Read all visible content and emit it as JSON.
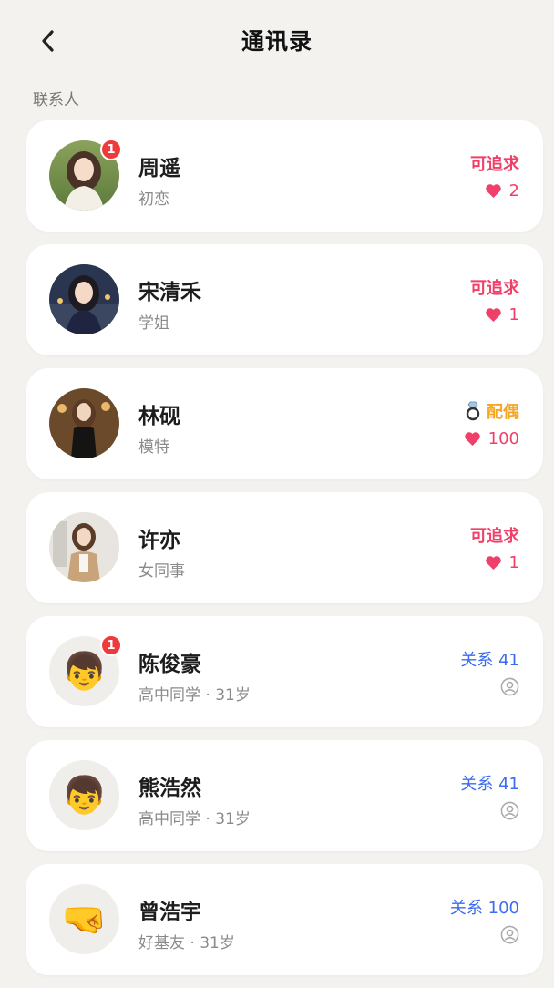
{
  "header": {
    "title": "通讯录"
  },
  "section_label": "联系人",
  "contacts": [
    {
      "name": "周遥",
      "subtitle": "初恋",
      "status": "可追求",
      "value": "2",
      "badge": "1"
    },
    {
      "name": "宋清禾",
      "subtitle": "学姐",
      "status": "可追求",
      "value": "1"
    },
    {
      "name": "林砚",
      "subtitle": "模特",
      "status": "配偶",
      "value": "100"
    },
    {
      "name": "许亦",
      "subtitle": "女同事",
      "status": "可追求",
      "value": "1"
    },
    {
      "name": "陈俊豪",
      "subtitle": "高中同学 · 31岁",
      "status": "关系 41",
      "badge": "1",
      "emoji": "👦"
    },
    {
      "name": "熊浩然",
      "subtitle": "高中同学 · 31岁",
      "status": "关系 41",
      "emoji": "👦"
    },
    {
      "name": "曾浩宇",
      "subtitle": "好基友 · 31岁",
      "status": "关系 100",
      "emoji": "🤜"
    }
  ],
  "colors": {
    "pursue": "#f0406a",
    "spouse": "#f5a623",
    "relation": "#3c6cf0",
    "badge": "#f0393a"
  },
  "icons": [
    "back-arrow-icon",
    "heart-icon",
    "ring-icon",
    "person-icon"
  ]
}
